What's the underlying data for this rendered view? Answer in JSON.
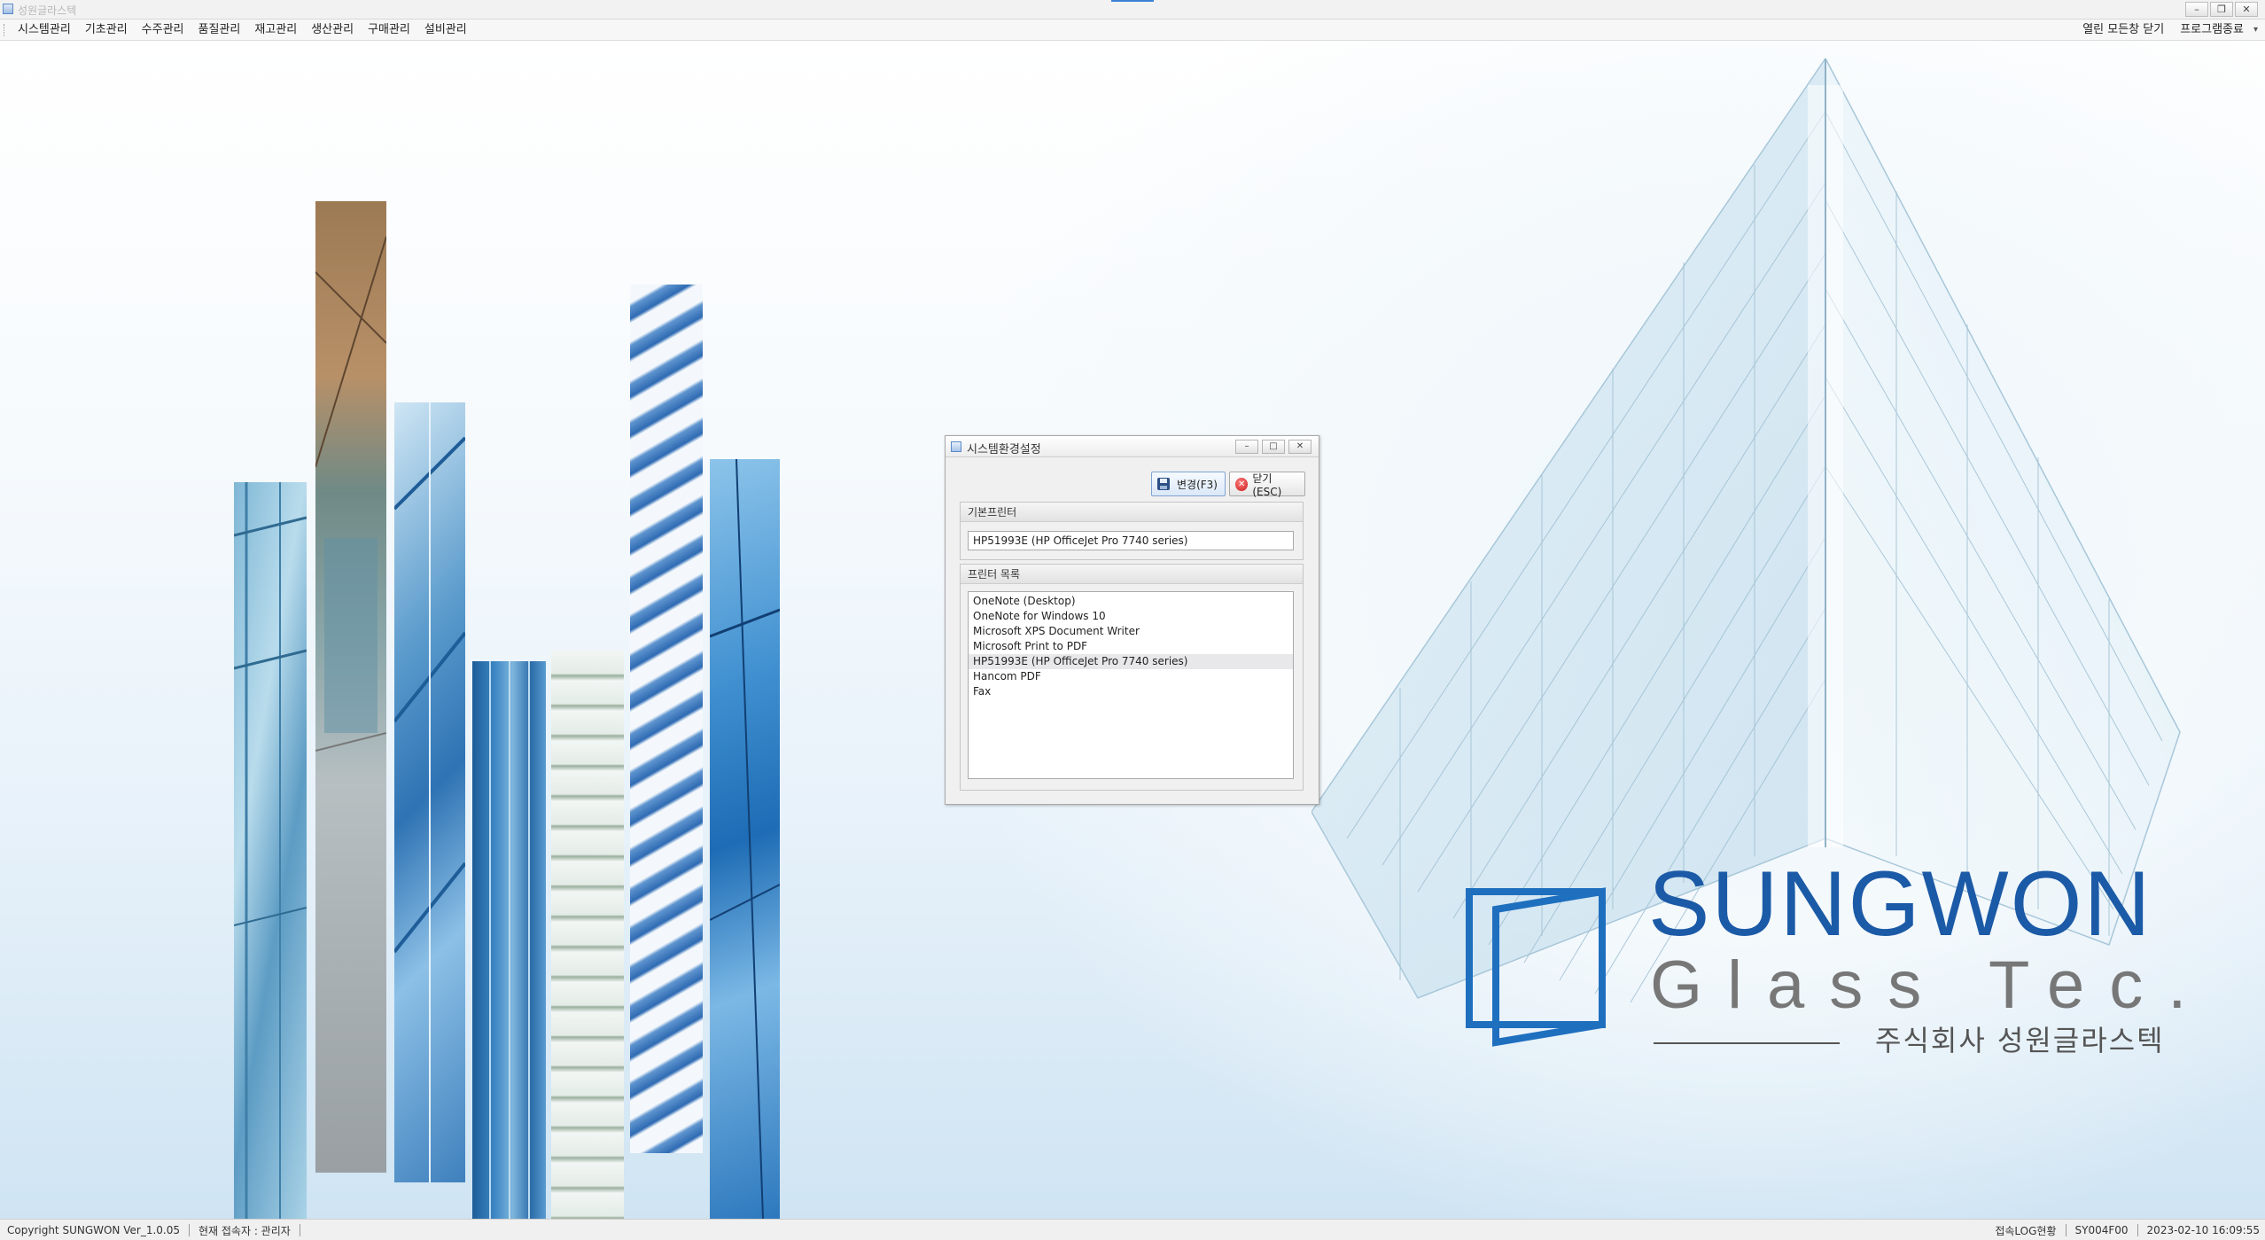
{
  "window": {
    "title": "성원글라스텍",
    "minimize": "–",
    "restore": "❐",
    "close": "✕"
  },
  "menu": {
    "items": [
      "시스템관리",
      "기초관리",
      "수주관리",
      "품질관리",
      "재고관리",
      "생산관리",
      "구매관리",
      "설비관리"
    ],
    "right_items": [
      "열린 모든창 닫기",
      "프로그램종료"
    ],
    "overflow_arrow": "▾"
  },
  "logo": {
    "main": "SUNGWON",
    "sub": "Glass Tec.",
    "korean": "주식회사 성원글라스텍",
    "brand_color": "#1b5aa6"
  },
  "dialog": {
    "title": "시스템환경설정",
    "minimize": "–",
    "maximize": "□",
    "close": "✕",
    "save_button": "변경(F3)",
    "close_button": "닫기(ESC)",
    "default_printer_header": "기본프린터",
    "default_printer_value": "HP51993E (HP OfficeJet Pro 7740 series)",
    "printer_list_header": "프린터 목록",
    "printers": [
      "OneNote (Desktop)",
      "OneNote for Windows 10",
      "Microsoft XPS Document Writer",
      "Microsoft Print to PDF",
      "HP51993E (HP OfficeJet Pro 7740 series)",
      "Hancom PDF",
      "Fax"
    ],
    "selected_printer_index": 4
  },
  "status": {
    "copyright": "Copyright SUNGWON Ver_1.0.05",
    "user": "현재 접속자 : 관리자",
    "log_link": "접속LOG현황",
    "screen_code": "SY004F00",
    "datetime": "2023-02-10 16:09:55"
  }
}
